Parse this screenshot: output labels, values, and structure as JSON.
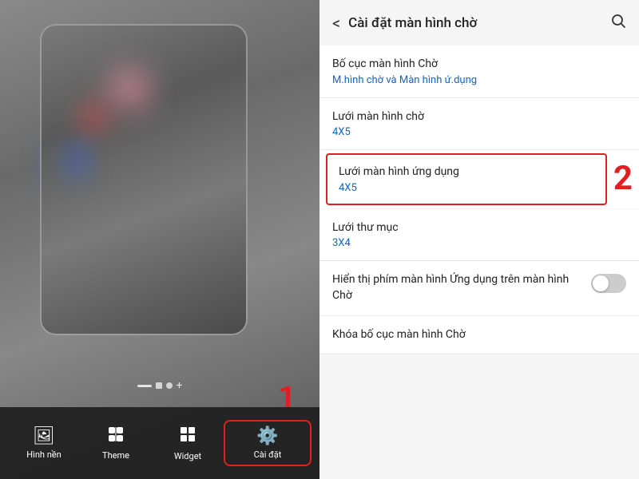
{
  "left": {
    "dots": [
      "dash",
      "square",
      "circle",
      "plus"
    ],
    "number1": "1",
    "bottomBar": {
      "items": [
        {
          "id": "hinhnen",
          "icon": "🖼",
          "label": "Hình nền",
          "active": false
        },
        {
          "id": "theme",
          "icon": "▼",
          "label": "Theme",
          "active": false
        },
        {
          "id": "widget",
          "icon": "⊞",
          "label": "Widget",
          "active": false
        },
        {
          "id": "caidat",
          "icon": "⚙",
          "label": "Cài đặt",
          "active": true
        }
      ]
    }
  },
  "right": {
    "header": {
      "backLabel": "<",
      "title": "Cài đặt màn hình chờ",
      "searchIcon": "🔍"
    },
    "items": [
      {
        "id": "bo-cuc",
        "title": "Bố cục màn hình Chờ",
        "subtitle": "M.hình chờ và Màn hình ứ.dụng",
        "highlighted": false,
        "hasToggle": false
      },
      {
        "id": "luoi-man-hinh-cho",
        "title": "Lưới màn hình chờ",
        "subtitle": "4X5",
        "highlighted": false,
        "hasToggle": false
      },
      {
        "id": "luoi-man-hinh-ung-dung",
        "title": "Lưới màn hình ứng dụng",
        "subtitle": "4X5",
        "highlighted": true,
        "hasToggle": false,
        "badge": "2"
      },
      {
        "id": "luoi-thu-muc",
        "title": "Lưới thư mục",
        "subtitle": "3X4",
        "highlighted": false,
        "hasToggle": false
      },
      {
        "id": "hien-thi-phim",
        "title": "Hiển thị phím màn hình Ứng dụng trên màn hình Chờ",
        "subtitle": "",
        "highlighted": false,
        "hasToggle": true
      },
      {
        "id": "khoa-bo-cuc",
        "title": "Khóa bố cục màn hình Chờ",
        "subtitle": "",
        "highlighted": false,
        "hasToggle": false
      }
    ]
  }
}
